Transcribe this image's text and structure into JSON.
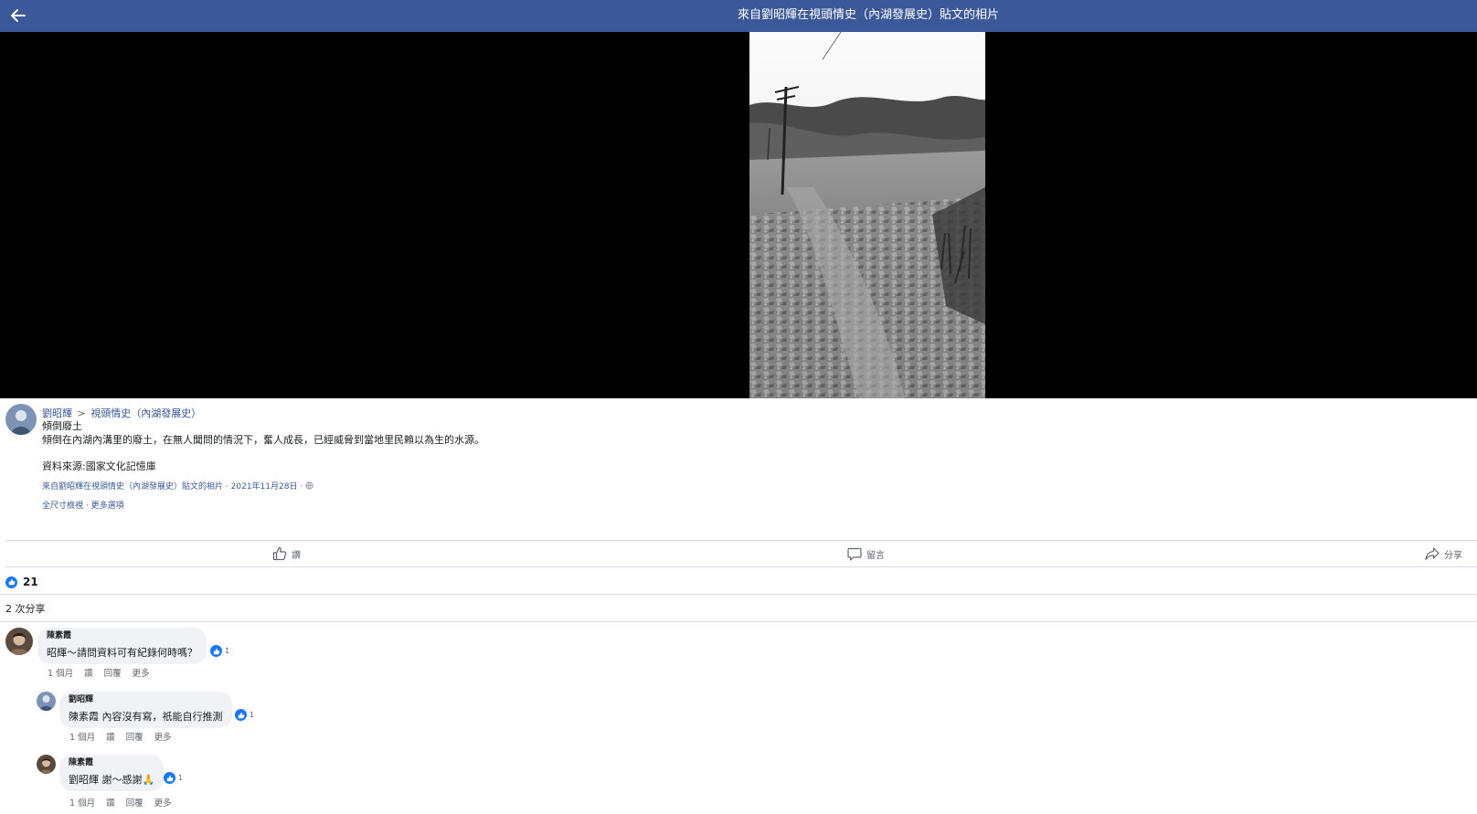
{
  "colors": {
    "brand": "#3b5998",
    "like": "#1877f2",
    "link": "#385898"
  },
  "header": {
    "back_icon": "arrow-left-icon",
    "title": "來自劉昭輝在視頭情史（內湖發展史）貼文的相片"
  },
  "post": {
    "author": "劉昭輝",
    "breadcrumb_sep": ">",
    "group": "視頭情史（內湖發展史）",
    "line1": "傾倒廢土",
    "line2": "傾倒在內湖內溝里的廢土，在無人聞問的情況下，奮人成長，已經威脅到當地里民賴以為生的水源。",
    "line3": "資料來源:國家文化記憶庫",
    "meta_source": "來自劉昭輝在視頭情史（內湖發展史）貼文的相片",
    "meta_sep": "·",
    "meta_date": "2021年11月28日",
    "meta_sep2": "·",
    "full_size": "全尺寸檢視",
    "link_sep": "·",
    "more_options": "更多選項"
  },
  "actions": {
    "like": "讚",
    "comment": "留言",
    "share": "分享"
  },
  "stats": {
    "reaction_count": "21",
    "shares": "2 次分享"
  },
  "comments": [
    {
      "name": "陳素霞",
      "text": "昭輝～請問資料可有紀錄何時嗎？",
      "reactions": "1",
      "time": "1 個月",
      "like": "讚",
      "reply": "回覆",
      "more": "更多"
    },
    {
      "name": "劉昭輝",
      "text": "陳素霞 內容沒有寫，祇能自行推測",
      "reactions": "1",
      "time": "1 個月",
      "like": "讚",
      "reply": "回覆",
      "more": "更多"
    },
    {
      "name": "陳素霞",
      "text": "劉昭輝 謝～感謝🙏",
      "reactions": "1",
      "time": "1 個月",
      "like": "讚",
      "reply": "回覆",
      "more": "更多"
    }
  ]
}
